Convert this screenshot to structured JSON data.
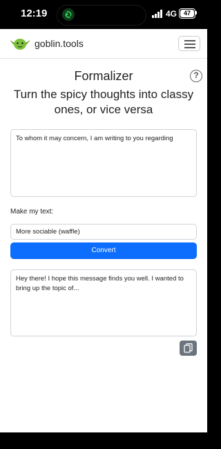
{
  "status_bar": {
    "time": "12:19",
    "network": "4G",
    "battery": "47"
  },
  "nav": {
    "brand": "goblin.tools"
  },
  "header": {
    "title": "Formalizer",
    "help_symbol": "?",
    "subtitle": "Turn the spicy thoughts into classy ones, or vice versa"
  },
  "form": {
    "input_text": "To whom it may concern, I am writing to you regarding",
    "make_label": "Make my text:",
    "selected_option": "More sociable (waffle)",
    "convert_label": "Convert",
    "output_text": "Hey there! I hope this message finds you well. I wanted to bring up the topic of..."
  },
  "colors": {
    "primary": "#0d6efd",
    "secondary": "#6c757d",
    "goblin_green": "#7cc23a"
  },
  "icons": [
    "link-icon",
    "signal-icon",
    "goblin-logo-icon",
    "menu-icon",
    "help-icon",
    "copy-icon"
  ]
}
